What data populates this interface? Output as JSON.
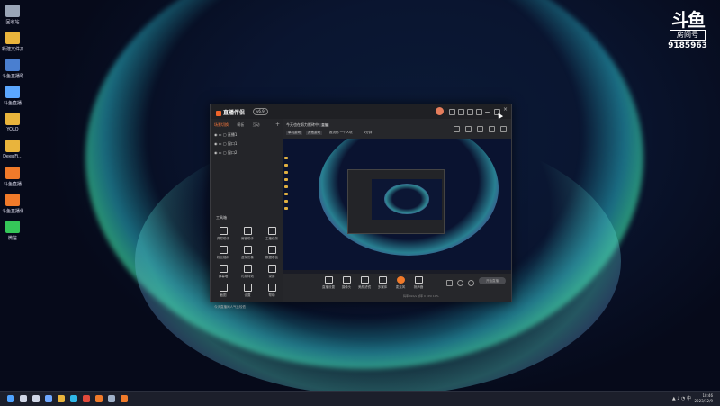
{
  "desktop": {
    "icons": [
      {
        "label": "回收站",
        "color": "#9aa6b8"
      },
      {
        "label": "新建文件夹",
        "color": "#e9b43c"
      },
      {
        "label": "斗鱼直播助手",
        "color": "#4a7fd0"
      },
      {
        "label": "斗鱼直播",
        "color": "#5ba7ff"
      },
      {
        "label": "YOLO",
        "color": "#e9b43c"
      },
      {
        "label": "DeepFi...",
        "color": "#e9b43c"
      },
      {
        "label": "斗鱼直播",
        "color": "#f07a2a"
      },
      {
        "label": "斗鱼直播伴侣",
        "color": "#f07a2a"
      },
      {
        "label": "微信",
        "color": "#35c759"
      }
    ]
  },
  "watermark": {
    "logo": "斗鱼",
    "room_label": "房间号",
    "room_number": "9185963"
  },
  "app": {
    "title": "直播伴侣",
    "version": "v6.9",
    "scene_tabs": [
      "场景切换",
      "模板",
      "互动"
    ],
    "scenes": [
      "直播1",
      "窗口1",
      "窗口2"
    ],
    "tools_title": "工具箱",
    "tools": [
      {
        "label": "弹幕助手"
      },
      {
        "label": "房管助手"
      },
      {
        "label": "主播任务"
      },
      {
        "label": "粉丝福利"
      },
      {
        "label": "虚拟形象"
      },
      {
        "label": "数据看板"
      },
      {
        "label": "弹幕墙"
      },
      {
        "label": "礼物特效"
      },
      {
        "label": "录屏"
      },
      {
        "label": "截图"
      },
      {
        "label": "设置"
      },
      {
        "label": "帮助"
      }
    ],
    "footer_notice": "今天直播间人气比较低",
    "stream_title": "今天也在努力搬砖中",
    "stream_badge": "直播",
    "meta_chips": [
      "单机游戏",
      "其他游戏",
      "1分钟"
    ],
    "meta_text": "推流码 一个人玩",
    "controls": [
      {
        "label": "直播设置"
      },
      {
        "label": "摄像头"
      },
      {
        "label": "美颜滤镜"
      },
      {
        "label": "多媒体"
      },
      {
        "label": "麦克风"
      },
      {
        "label": "扬声器"
      }
    ],
    "live_button": "开始直播",
    "stats": "码率 0kb/s  帧率 0  CPU 10%"
  },
  "taskbar": {
    "icons": [
      "windows-icon",
      "search-icon",
      "task-view-icon",
      "widgets-icon",
      "explorer-icon",
      "edge-icon",
      "chrome-icon",
      "douyu-icon",
      "steam-icon",
      "live-companion-icon"
    ],
    "tray_text": "中",
    "time": "18:46",
    "date": "2023/12/9"
  }
}
